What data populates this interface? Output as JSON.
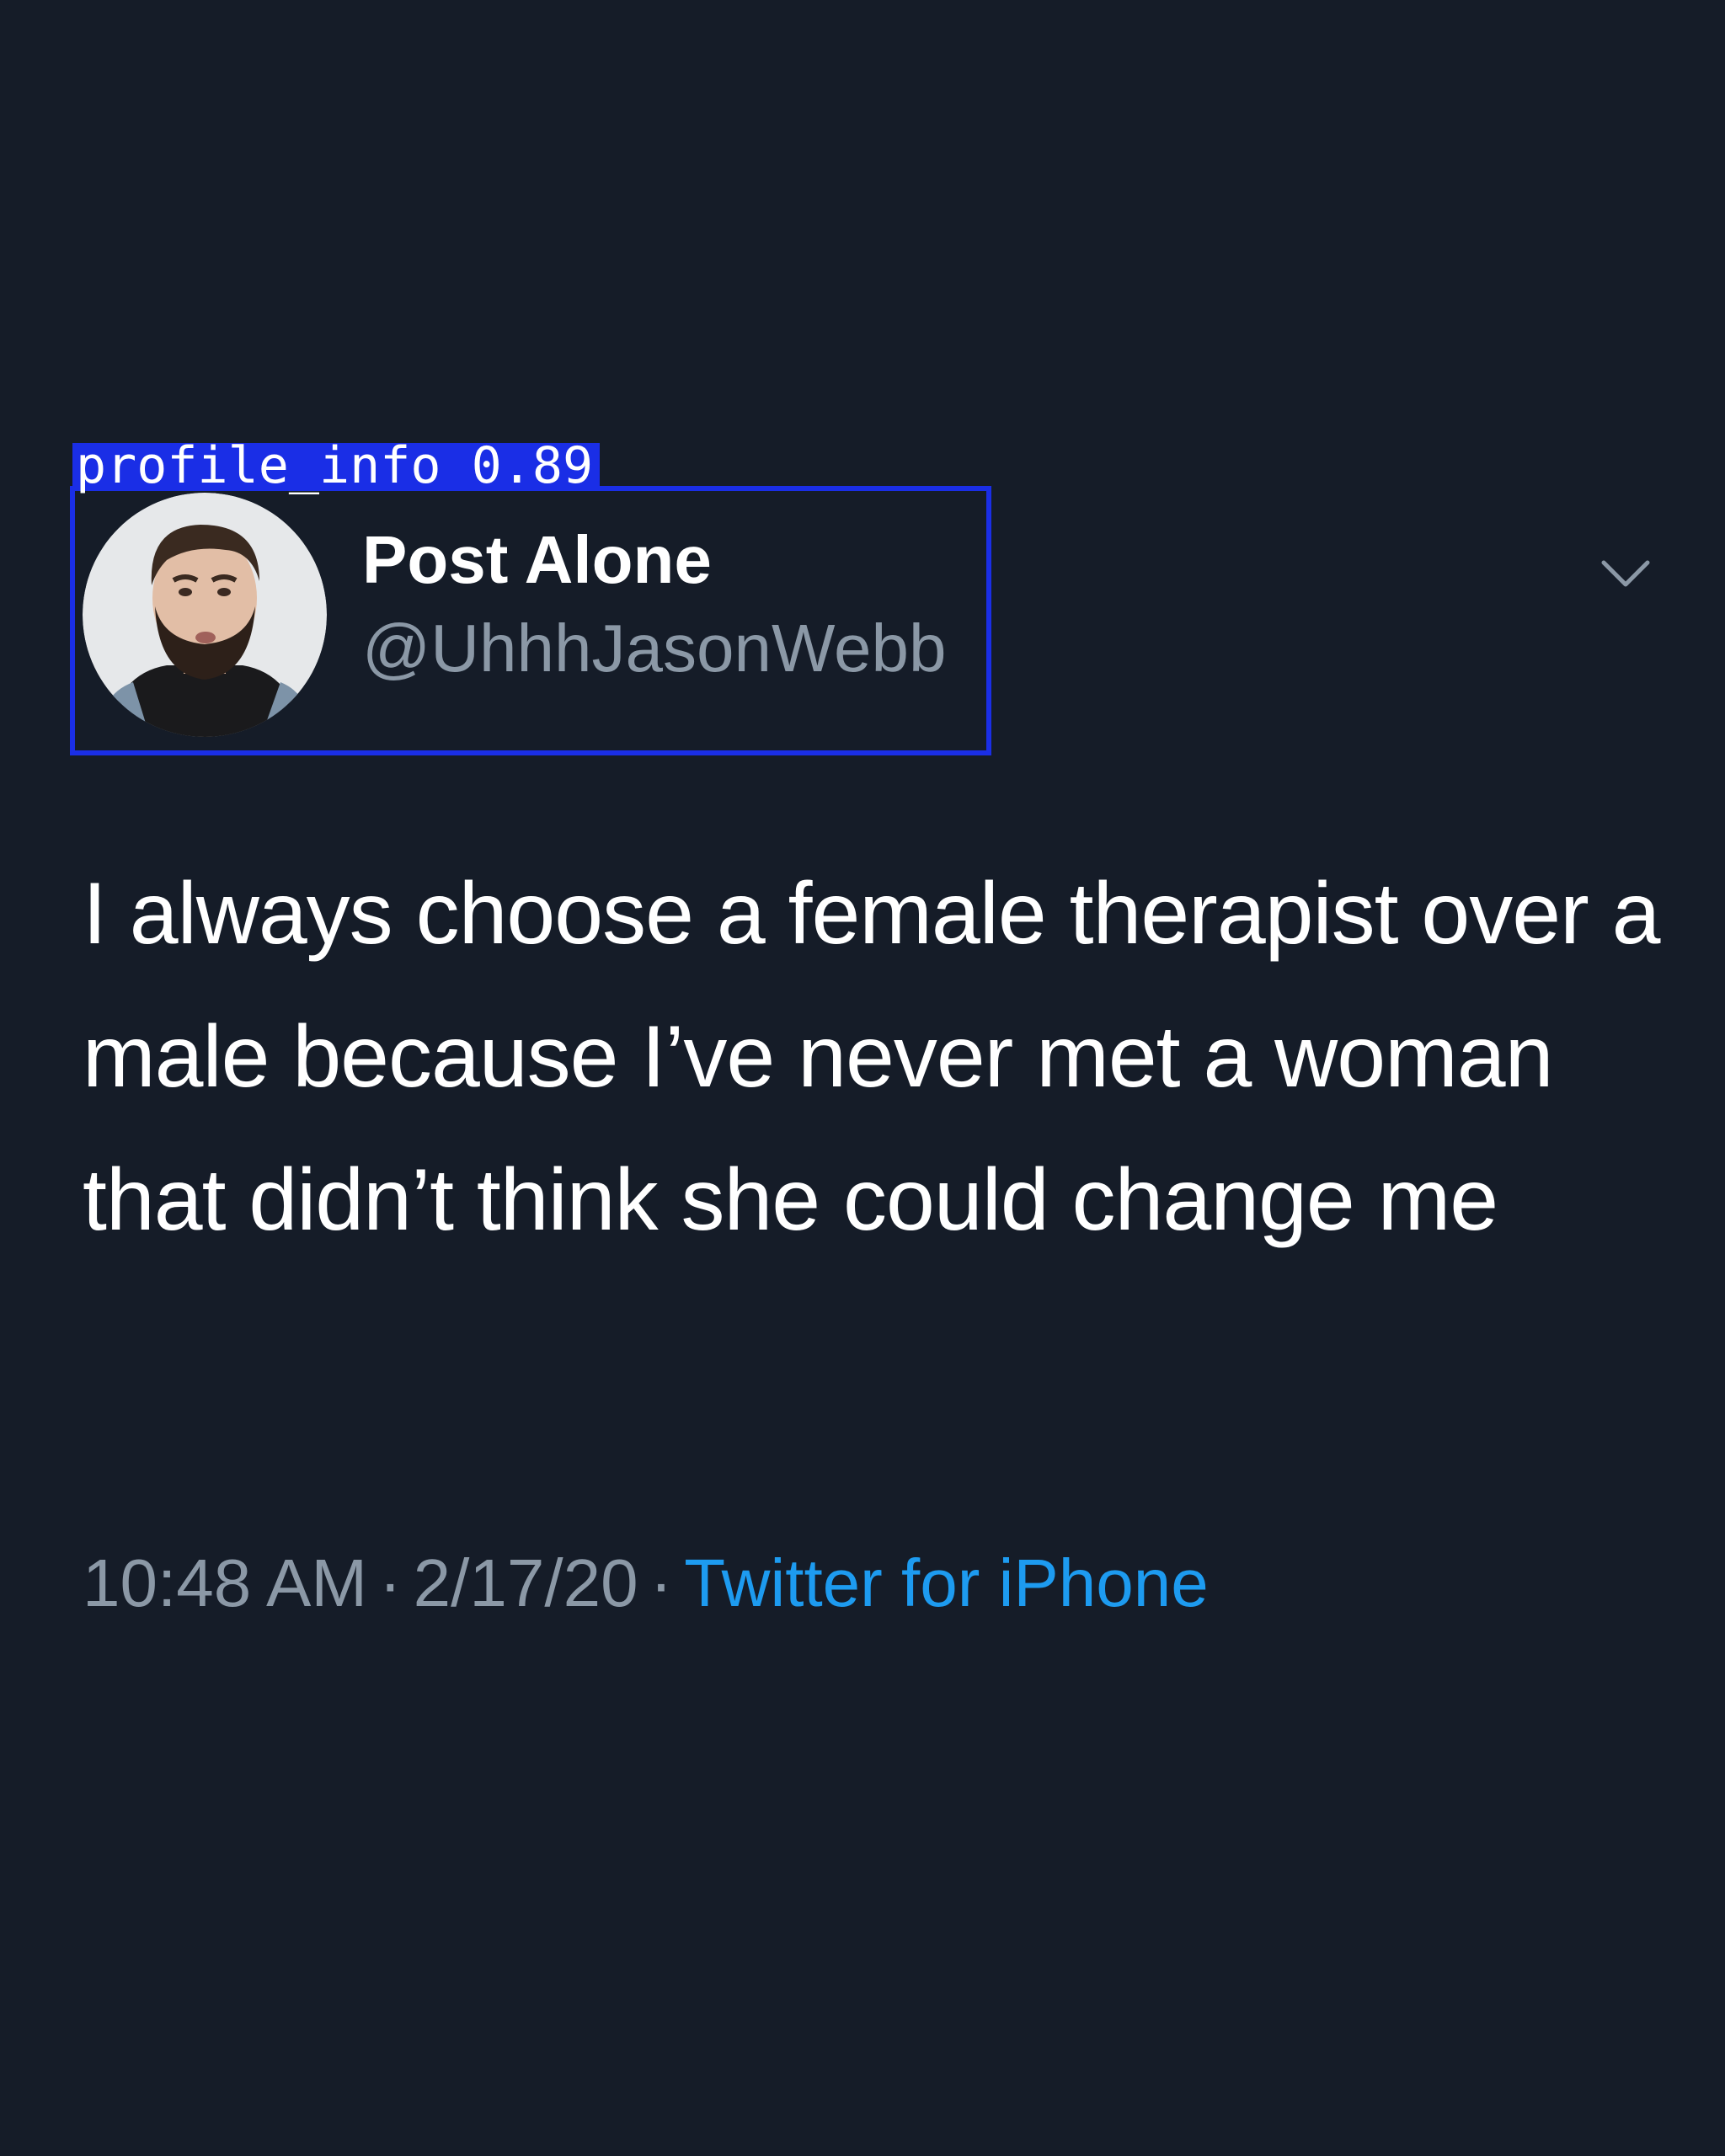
{
  "annotation": {
    "label": "profile_info",
    "score": "0.89",
    "color": "#1a2ee6"
  },
  "profile": {
    "display_name": "Post Alone",
    "handle": "@UhhhJasonWebb",
    "avatar_icon": "avatar-photo",
    "menu_icon": "chevron-down-icon"
  },
  "tweet": {
    "text": "I always choose a female therapist over a male because I’ve never met a woman that didn’t think she could change me",
    "time": "10:48 AM",
    "separator": "·",
    "date": "2/17/20",
    "source": "Twitter for iPhone",
    "source_color": "#1d9bf0"
  },
  "theme": {
    "background": "#151c28",
    "text_primary": "#ffffff",
    "text_secondary": "#8b98a6"
  }
}
